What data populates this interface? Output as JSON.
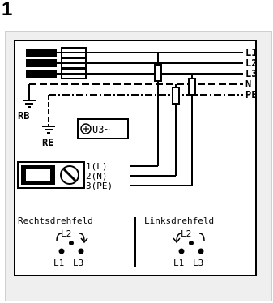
{
  "figure_number": "1",
  "bus_labels": [
    "L1",
    "L2",
    "L3",
    "N",
    "PE"
  ],
  "ground_labels": [
    "RB",
    "RE"
  ],
  "test_symbol_label": "U3~",
  "meter_terminals": [
    "1(L)",
    "2(N)",
    "3(PE)"
  ],
  "rotation_fields": [
    {
      "title": "Rechtsdrehfeld",
      "top": "L2",
      "bottom_left": "L1",
      "bottom_right": "L3"
    },
    {
      "title": "Linksdrehfeld",
      "top": "L2",
      "bottom_left": "L1",
      "bottom_right": "L3"
    }
  ]
}
